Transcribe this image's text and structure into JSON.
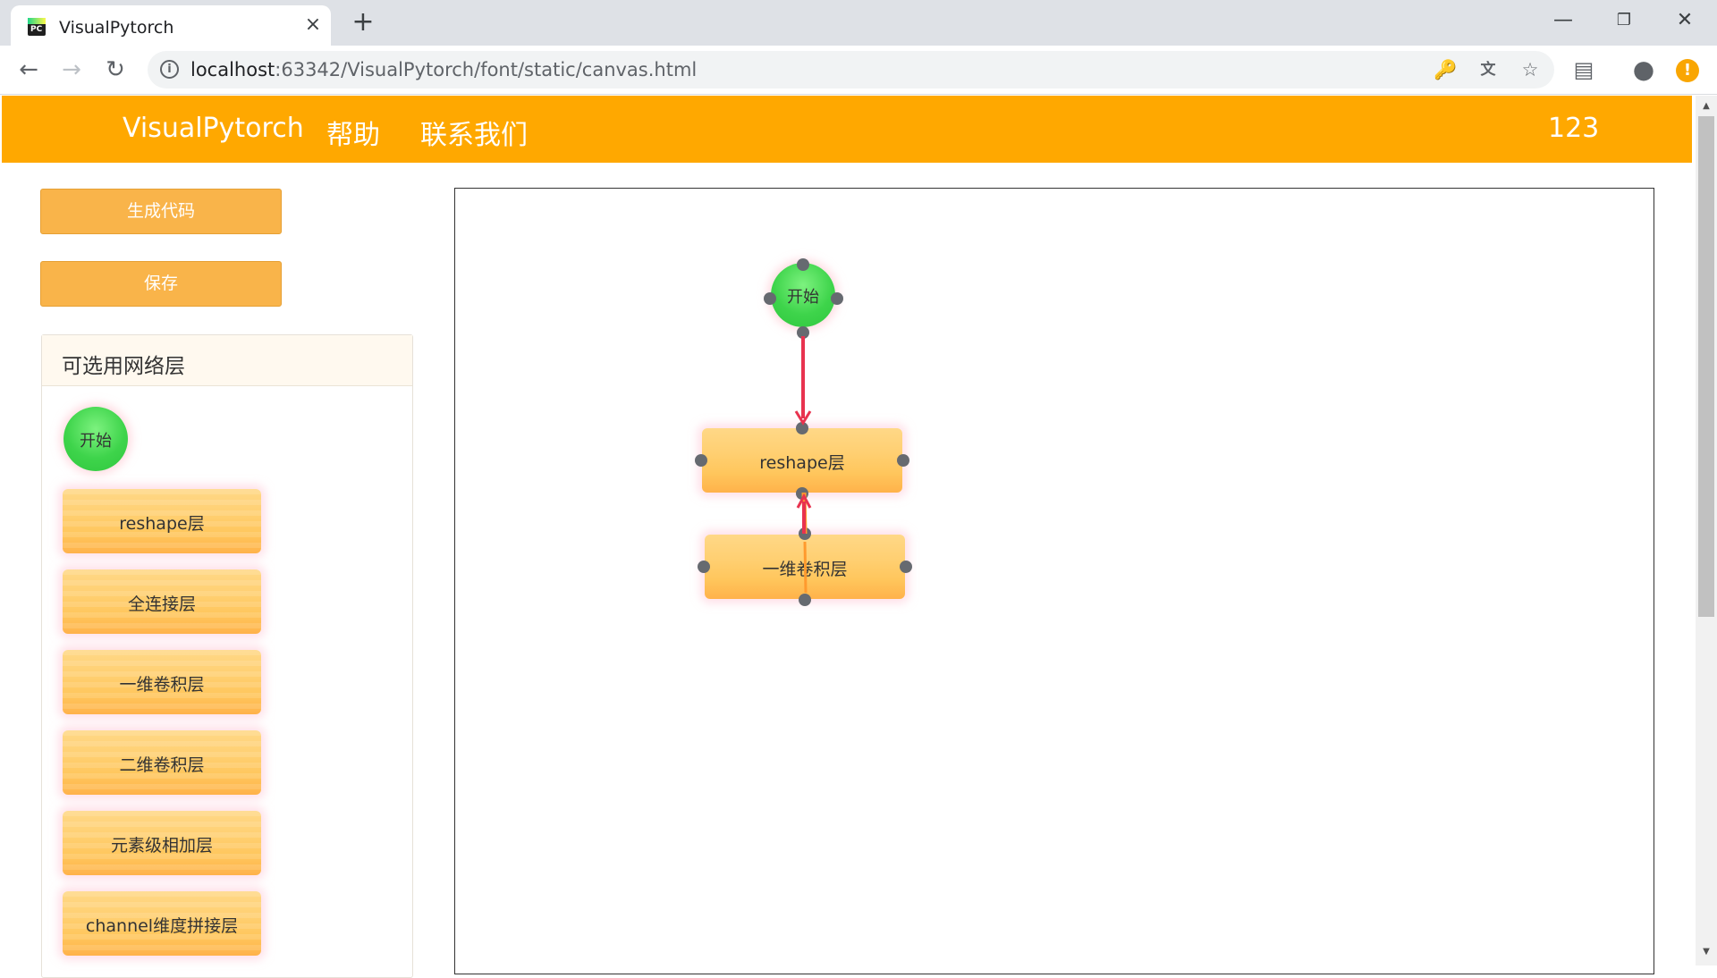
{
  "browser": {
    "tab_title": "VisualPytorch",
    "tab_close": "×",
    "new_tab": "+",
    "url_host": "localhost",
    "url_rest": ":63342/VisualPytorch/font/static/canvas.html"
  },
  "header": {
    "brand": "VisualPytorch",
    "nav": [
      "帮助",
      "联系我们"
    ],
    "user": "123"
  },
  "sidebar": {
    "generate_label": "生成代码",
    "save_label": "保存",
    "panel_title": "可选用网络层",
    "start_label": "开始",
    "layers": [
      "reshape层",
      "全连接层",
      "一维卷积层",
      "二维卷积层",
      "元素级相加层",
      "channel维度拼接层"
    ]
  },
  "canvas": {
    "nodes": {
      "start": "开始",
      "reshape": "reshape层",
      "conv1d": "一维卷积层"
    },
    "edge_color": "#e8334f"
  },
  "colors": {
    "header": "#ffa800",
    "button": "#f9b44a",
    "node_green": "#3ed44b",
    "node_orange": "#ffc65c"
  }
}
